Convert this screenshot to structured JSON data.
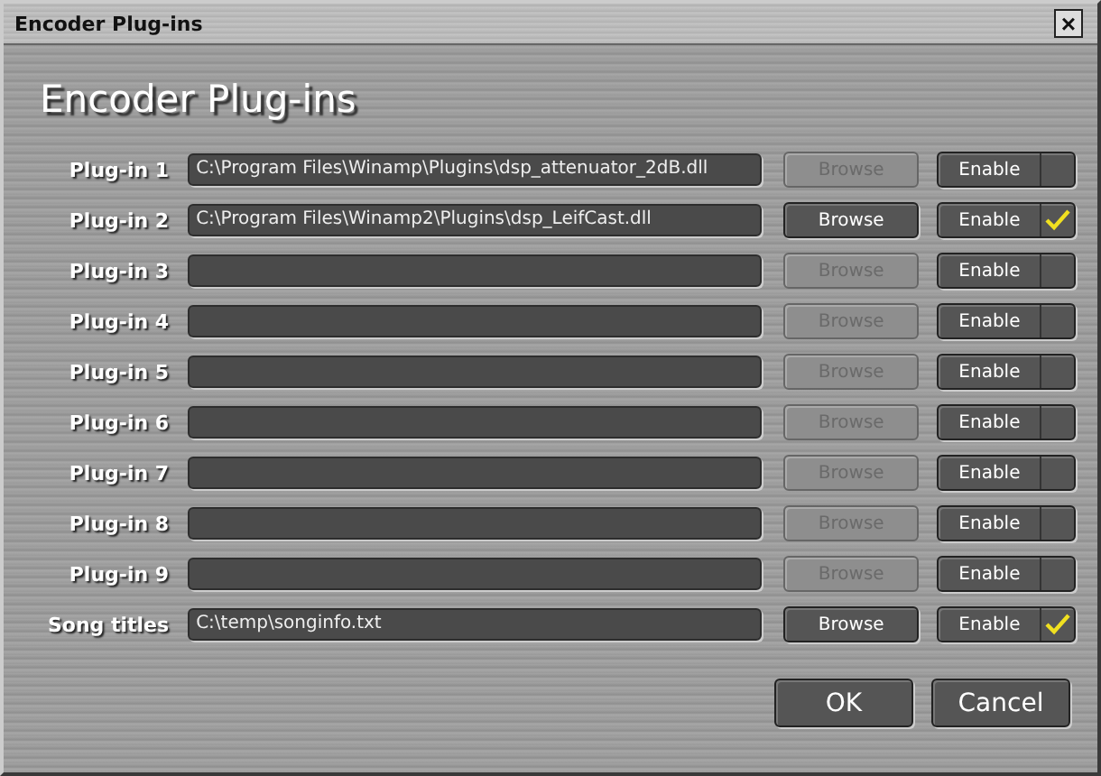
{
  "window": {
    "title": "Encoder Plug-ins",
    "close": "×"
  },
  "heading": "Encoder Plug-ins",
  "rows": [
    {
      "label": "Plug-in 1",
      "path": "C:\\Program Files\\Winamp\\Plugins\\dsp_attenuator_2dB.dll",
      "browse": "Browse",
      "browse_disabled": true,
      "enable": "Enable",
      "checked": false
    },
    {
      "label": "Plug-in 2",
      "path": "C:\\Program Files\\Winamp2\\Plugins\\dsp_LeifCast.dll",
      "browse": "Browse",
      "browse_disabled": false,
      "enable": "Enable",
      "checked": true
    },
    {
      "label": "Plug-in 3",
      "browse": "Browse",
      "browse_disabled": true,
      "enable": "Enable",
      "checked": false
    },
    {
      "label": "Plug-in 4",
      "browse": "Browse",
      "browse_disabled": true,
      "enable": "Enable",
      "checked": false
    },
    {
      "label": "Plug-in 5",
      "browse": "Browse",
      "browse_disabled": true,
      "enable": "Enable",
      "checked": false
    },
    {
      "label": "Plug-in 6",
      "browse": "Browse",
      "browse_disabled": true,
      "enable": "Enable",
      "checked": false
    },
    {
      "label": "Plug-in 7",
      "browse": "Browse",
      "browse_disabled": true,
      "enable": "Enable",
      "checked": false
    },
    {
      "label": "Plug-in 8",
      "browse": "Browse",
      "browse_disabled": true,
      "enable": "Enable",
      "checked": false
    },
    {
      "label": "Plug-in 9",
      "browse": "Browse",
      "browse_disabled": true,
      "enable": "Enable",
      "checked": false
    },
    {
      "label": "Song titles",
      "path": "C:\\temp\\songinfo.txt",
      "browse": "Browse",
      "browse_disabled": false,
      "enable": "Enable",
      "checked": true
    }
  ],
  "buttons": [
    "OK",
    "Cancel"
  ]
}
